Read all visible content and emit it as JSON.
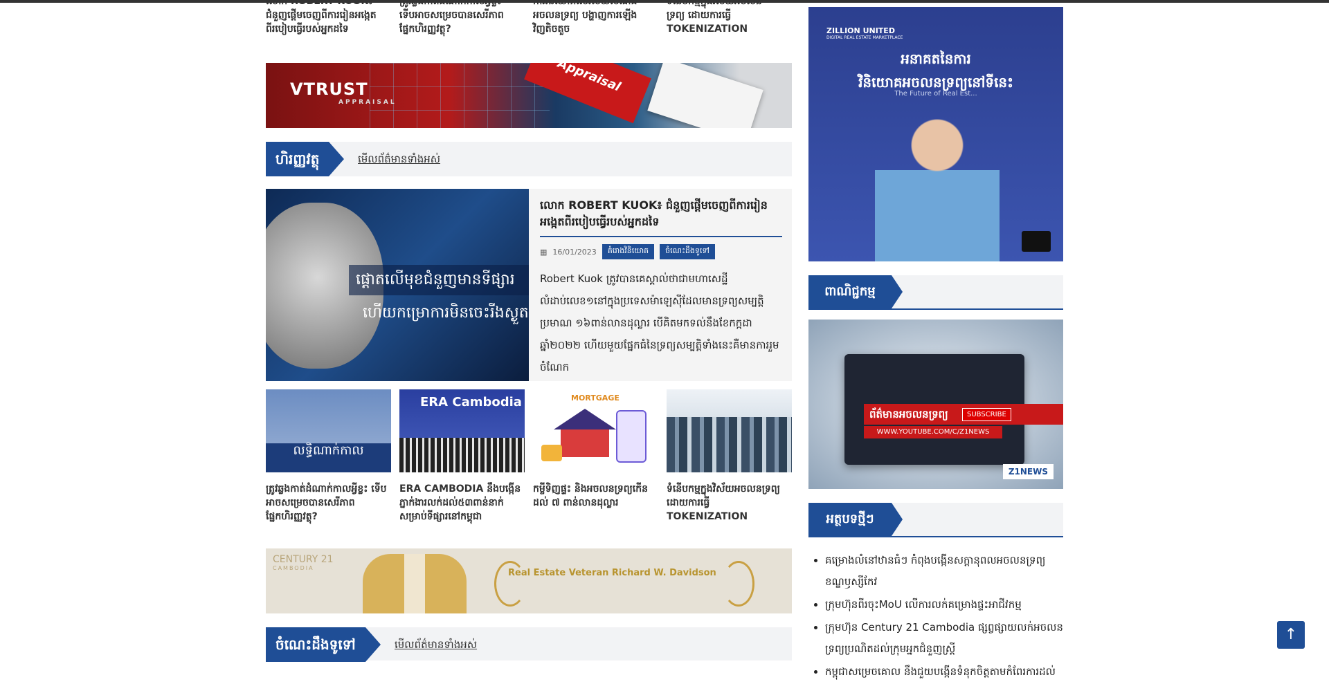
{
  "top_articles": [
    {
      "title": "លោក ROBERT KUOK៖ ជំនួញផ្តើមចេញពីការរៀនអង្កេតពីរបៀបធ្វើរបស់អ្នកដទៃ"
    },
    {
      "title": "ត្រូវឆ្លងកាត់ដំណាក់កាលអ្វីខ្លះ ទើបអាចសម្រេចបានសេរីភាពផ្នែកហិរញ្ញវត្ថុ?"
    },
    {
      "title": "ការវិនិយោគលើវិស័យសំណង់ អចលនទ្រព្យ បង្ហាញការឡើងវិញតិចតួច"
    },
    {
      "title": "ទំនើបកម្មក្នុងវិស័យអចលនទ្រព្យ ដោយការធ្វើ TOKENIZATION"
    }
  ],
  "vtrust_banner": {
    "logo": "VTRUST",
    "logo_sub": "APPRAISAL",
    "ribbon": "Appraisal"
  },
  "section_finance": {
    "tag": "ហិរញ្ញវត្ថុ",
    "more": "មើលព័ត៌មានទាំងអស់"
  },
  "feature": {
    "img_caption1": "ផ្តោតលើមុខជំនួញមានទីផ្សារ",
    "img_caption2": "ហើយកម្រោការមិនចេះរីងស្ងួត",
    "title": "លោក ROBERT KUOK៖ ជំនួញផ្តើមចេញពីការរៀនអង្កេតពីរបៀបធ្វើរបស់អ្នកដទៃ",
    "date": "16/01/2023",
    "categories": [
      "គំរោងវិនិយោគ",
      "ចំណេះដឹងទូទៅ"
    ],
    "excerpt": "Robert Kuok ត្រូវបានគេស្គាល់ថាជាមហាសេដ្ឋីលំដាប់លេខ១នៅក្នុងប្រទេសម៉ាឡេស៊ីដែលមានទ្រព្យសម្បត្តិប្រមាណ ១៦ពាន់លានដុល្លារ បើគិតមកទល់នឹងខែកក្កដា ឆ្នាំ២០២២ ហើយមួយផ្នែកធំនៃទ្រព្យសម្បត្តិទាំងនេះគឺមានការរួមចំណែក"
  },
  "cards": [
    {
      "title": "ត្រូវឆ្លងកាត់ដំណាក់កាលអ្វីខ្លះ ទើបអាចសម្រេចបានសេរីភាពផ្នែកហិរញ្ញវត្ថុ?",
      "thumb_text": "លទ្ធិណាក់កាល"
    },
    {
      "title": "ERA CAMBODIA នឹងបង្កើនភ្នាក់ងារលក់ដល់៥៣ពាន់នាក់សម្រាប់ទីផ្សារនៅកម្ពុជា",
      "thumb_text": "ERA Cambodia"
    },
    {
      "title": "កម្ចីទិញផ្ទះ និងអចលនទ្រព្យកើនដល់ ៧ ពាន់លានដុល្លារ",
      "thumb_text": "MORTGAGE"
    },
    {
      "title": "ទំនើបកម្មក្នុងវិស័យអចលនទ្រព្យ ដោយការធ្វើ TOKENIZATION",
      "thumb_text": ""
    }
  ],
  "century_banner": {
    "logo": "CENTURY 21",
    "logo_sub": "CAMBODIA",
    "text": "Real Estate Veteran Richard W. Davidson"
  },
  "section_general": {
    "tag": "ចំណេះដឹងទូទៅ",
    "more": "មើលព័ត៌មានទាំងអស់"
  },
  "side_ad": {
    "brand": "ZILLION UNITED",
    "brand_sub": "DIGITAL REAL ESTATE MARKETPLACE",
    "headline1": "អនាគតនៃការ",
    "headline2": "វិនិយោគអចលនទ្រព្យនៅទីនេះ",
    "subline": "The Future of Real Est..."
  },
  "side_commerce": {
    "tag": "ពាណិជ្ជកម្ម"
  },
  "video": {
    "title": "ព័ត៌មានអចលនទ្រព្យ",
    "subscribe": "SUBSCRIBE",
    "url": "WWW.YOUTUBE.COM/C/Z1NEWS",
    "logo": "Z1NEWS"
  },
  "side_latest": {
    "tag": "អត្ថបទថ្មីៗ",
    "items": [
      "គម្រោងលំនៅឋានធំៗ កំពុងបង្កើនសក្តានុពលអចលនទ្រព្យខណ្ឌឫស្សីកែវ",
      "ក្រុមហ៊ុនពីរចុះMoU លើការលក់គម្រោងផ្ទះអាជីវកម្ម",
      "ក្រុមហ៊ុន Century 21 Cambodia ផ្សព្វផ្សាយលក់អចលនទ្រព្យប្រណិតដល់ក្រុមអ្នកជំនួញស្ត្រី",
      "កម្ពុជាសម្រេចគោល នឹងជួយបង្កើនទំនុកចិត្តតាមកំពែរការដល់"
    ]
  },
  "to_top": "↑"
}
